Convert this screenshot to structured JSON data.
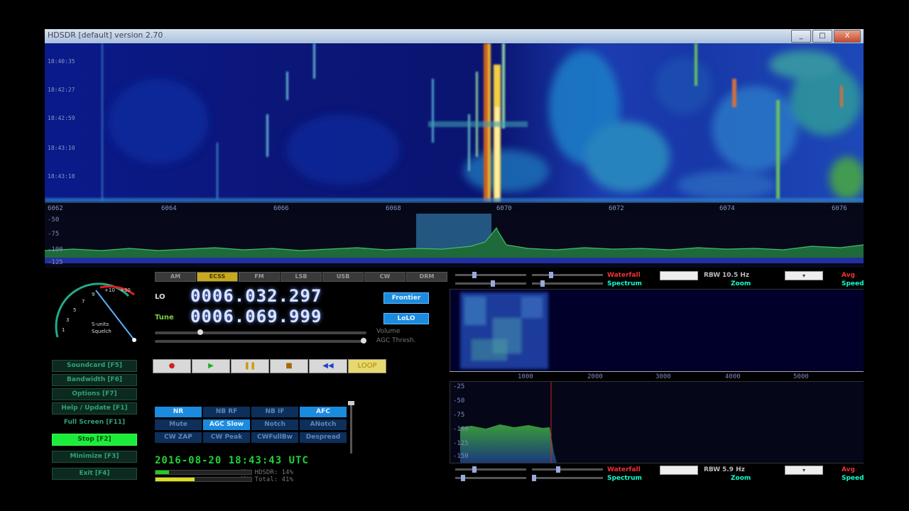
{
  "window": {
    "title": "HDSDR [default]  version 2.70",
    "controls": [
      "_",
      "□",
      "X"
    ]
  },
  "main_spectrum": {
    "freq_ticks": [
      "6062",
      "6064",
      "6066",
      "6068",
      "6070",
      "6072",
      "6074",
      "6076"
    ],
    "db_ticks": [
      "-50",
      "-75",
      "-100",
      "-125"
    ],
    "time_labels": [
      "18:40:35",
      "18:42:27",
      "18:42:59",
      "18:43:10",
      "18:43:18"
    ]
  },
  "modes": [
    "AM",
    "ECSS",
    "FM",
    "LSB",
    "USB",
    "CW",
    "DRM"
  ],
  "active_mode": 1,
  "lo": {
    "label": "LO",
    "value": "0006.032.297",
    "button": "Frontier"
  },
  "tune": {
    "label": "Tune",
    "value": "0006.069.999",
    "button": "LoLO"
  },
  "slider_labels": {
    "volume": "Volume",
    "agc": "AGC Thresh."
  },
  "transport": [
    "●",
    "▶",
    "❚❚",
    "■",
    "◀◀",
    "LOOP"
  ],
  "smeter": {
    "label": "S-units",
    "sublabel": "Squelch",
    "scale": [
      "1",
      "3",
      "5",
      "7",
      "9",
      "+10",
      "+30"
    ]
  },
  "side_buttons": [
    {
      "label": "Soundcard  [F5]",
      "on": false
    },
    {
      "label": "Bandwidth  [F6]",
      "on": false
    },
    {
      "label": "Options  [F7]",
      "on": false
    },
    {
      "label": "Help / Update  [F1]",
      "on": false
    },
    {
      "label": "Full Screen  [F11]",
      "on": false
    },
    {
      "label": "Stop  [F2]",
      "on": true
    },
    {
      "label": "Minimize  [F3]",
      "on": false
    },
    {
      "label": "Exit  [F4]",
      "on": false
    }
  ],
  "dsp_buttons": [
    {
      "label": "NR",
      "on": true
    },
    {
      "label": "NB RF",
      "on": false
    },
    {
      "label": "NB IF",
      "on": false
    },
    {
      "label": "AFC",
      "on": true
    },
    {
      "label": "Mute",
      "on": false
    },
    {
      "label": "AGC Slow",
      "on": true
    },
    {
      "label": "Notch",
      "on": false
    },
    {
      "label": "ANotch",
      "on": false
    },
    {
      "label": "CW ZAP",
      "on": false
    },
    {
      "label": "CW Peak",
      "on": false
    },
    {
      "label": "CWFullBw",
      "on": false
    },
    {
      "label": "Despread",
      "on": false
    }
  ],
  "status": {
    "clock": "2016-08-20  18:43:43 UTC",
    "cpu_hdsdr": "CPU HDSDR:  14%",
    "cpu_total": "CPU Total:  41%",
    "cpu_hdsdr_level": 0.14,
    "cpu_total_level": 0.41
  },
  "audio_top": {
    "waterfall": "Waterfall",
    "rbw_label": "RBW",
    "rbw_value": "10.5 Hz",
    "avg": "Avg",
    "spectrum": "Spectrum",
    "zoom": "Zoom",
    "speed": "Speed"
  },
  "audio_bottom": {
    "waterfall": "Waterfall",
    "rbw_label": "RBW",
    "rbw_value": "5.9 Hz",
    "avg": "Avg",
    "spectrum": "Spectrum",
    "zoom": "Zoom",
    "speed": "Speed"
  },
  "audio_axis": [
    "1000",
    "2000",
    "3000",
    "4000",
    "5000"
  ],
  "audio_db": [
    "-25",
    "-50",
    "-75",
    "-100",
    "-125",
    "-150"
  ],
  "colors": {
    "accent_blue": "#1b8be0",
    "green_on": "#1aee3a",
    "mode_on": "#c9a91c",
    "clock": "#1fd23a"
  }
}
